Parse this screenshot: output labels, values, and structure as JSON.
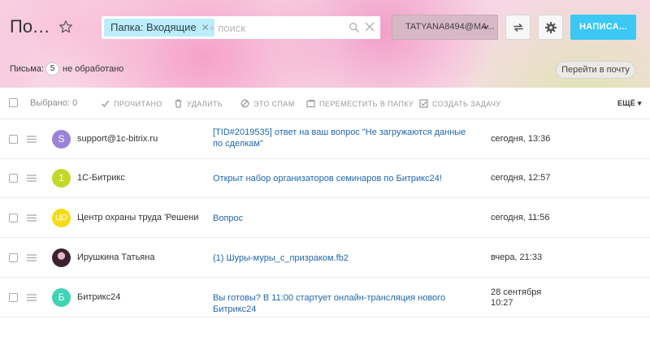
{
  "header": {
    "title": "Поч...",
    "folder_tag": "Папка: Входящие",
    "search_placeholder": "+ поиск",
    "account": "TATYANA8494@MA...",
    "write_button": "НАПИСА..."
  },
  "subbar": {
    "letters_label": "Письма:",
    "unread_count": "5",
    "unread_suffix": "не обработано",
    "goto_mail_button": "Перейти в почту"
  },
  "toolbar": {
    "selected": "Выбрано: 0",
    "read": "ПРОЧИТАНО",
    "delete": "УДАЛИТЬ",
    "spam": "ЭТО СПАМ",
    "move": "ПЕРЕМЕСТИТЬ В ПАПКУ",
    "task": "СОЗДАТЬ ЗАДАЧУ",
    "more": "ЕЩЁ"
  },
  "messages": [
    {
      "avatar_letter": "S",
      "avatar_color": "#9b82d9",
      "sender": "support@1c-bitrix.ru",
      "subject": "[TID#2019535] ответ на ваш вопрос \"Не загружаются данные по сделкам\"",
      "date": "сегодня, 13:36"
    },
    {
      "avatar_letter": "1",
      "avatar_color": "#c2d829",
      "sender": "1С-Битрикс",
      "subject": "Открыт набор организаторов семинаров по Битрикс24!",
      "date": "сегодня, 12:57"
    },
    {
      "avatar_letter": "ЦО",
      "avatar_color": "#f5dc12",
      "sender": "Центр охраны труда 'Решение",
      "subject": "Вопрос",
      "date": "сегодня, 11:56"
    },
    {
      "avatar_letter": "",
      "avatar_color": "#3a2230",
      "sender": "Ирушкина Татьяна",
      "subject": "(1) Шуры-муры_с_призраком.fb2",
      "date": "вчера, 21:33"
    },
    {
      "avatar_letter": "Б",
      "avatar_color": "#3fd4b3",
      "sender": "Битрикс24",
      "subject": "Вы готовы? В 11:00 стартует онлайн-трансляция нового Битрикс24",
      "date": "28 сентября 10:27"
    }
  ],
  "colors": {
    "accent": "#3bc8f5",
    "link": "#2067b0",
    "tag_bg": "#bcedfc"
  }
}
